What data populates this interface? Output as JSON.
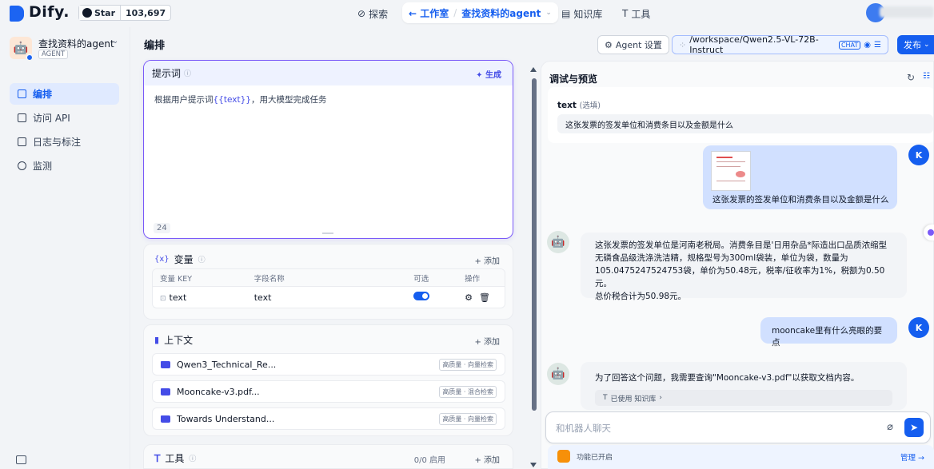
{
  "topnav": {
    "logo": "Dify.",
    "star_label": "Star",
    "star_count": "103,697",
    "explore": "探索",
    "workspace": "← 工作室",
    "current_app": "查找资料的agent",
    "knowledge": "知识库",
    "tools": "工具"
  },
  "sidebar": {
    "app_name": "查找资料的agent",
    "app_type": "AGENT",
    "items": [
      {
        "label": "编排",
        "active": true
      },
      {
        "label": "访问 API",
        "active": false
      },
      {
        "label": "日志与标注",
        "active": false
      },
      {
        "label": "监测",
        "active": false
      }
    ]
  },
  "header": {
    "title": "编排",
    "agent_settings": "Agent 设置",
    "model_path": "/workspace/Qwen2.5-VL-72B-Instruct",
    "model_tag": "CHAT",
    "publish": "发布"
  },
  "prompt": {
    "label": "提示词",
    "generate": "生成",
    "text_before": "根据用户提示词",
    "text_var": "{{text}}",
    "text_after": "，用大模型完成任务",
    "count": "24"
  },
  "variables": {
    "title": "变量",
    "add": "+ 添加",
    "headers": [
      "变量 KEY",
      "字段名称",
      "可选",
      "操作"
    ],
    "rows": [
      {
        "key": "text",
        "name": "text",
        "optional": true
      }
    ]
  },
  "context": {
    "title": "上下文",
    "add": "+ 添加",
    "datasets": [
      {
        "name": "Qwen3_Technical_Re...",
        "tag": "高质量 · 向量检索"
      },
      {
        "name": "Mooncake-v3.pdf...",
        "tag": "高质量 · 混合检索"
      },
      {
        "name": "Towards Understand...",
        "tag": "高质量 · 向量检索"
      }
    ]
  },
  "tools": {
    "title": "工具",
    "status": "0/0 启用",
    "add": "+ 添加"
  },
  "debug": {
    "title": "调试与预览",
    "var_label": "text",
    "var_optional": "(选填)",
    "var_value": "这张发票的签发单位和消费条目以及金额是什么",
    "messages": [
      {
        "role": "user",
        "avatar": "K",
        "text": "这张发票的签发单位和消费条目以及金额是什么",
        "has_image": true
      },
      {
        "role": "assistant",
        "lines": [
          "这张发票的签发单位是河南老税局。消费条目是'日用杂品*际造出口品质浓缩型",
          "无磷食品级洗涤洗洁精，规格型号为300ml袋装，单位为袋，数量为",
          "105.0475247524753袋，单价为50.48元，税率/征收率为1%，税额为0.50元。",
          "总价税合计为50.98元。"
        ]
      },
      {
        "role": "user",
        "avatar": "K",
        "text": "mooncake里有什么亮眼的要点"
      },
      {
        "role": "assistant",
        "lines": [
          "为了回答这个问题，我需要查询\"Mooncake-v3.pdf\"以获取文档内容。"
        ],
        "kb_used": "已使用 知识库"
      }
    ],
    "input_placeholder": "和机器人聊天",
    "features_text": "功能已开启",
    "manage": "管理 →"
  },
  "colors": {
    "accent": "#155eef",
    "prompt_border": "#7a5af8"
  }
}
